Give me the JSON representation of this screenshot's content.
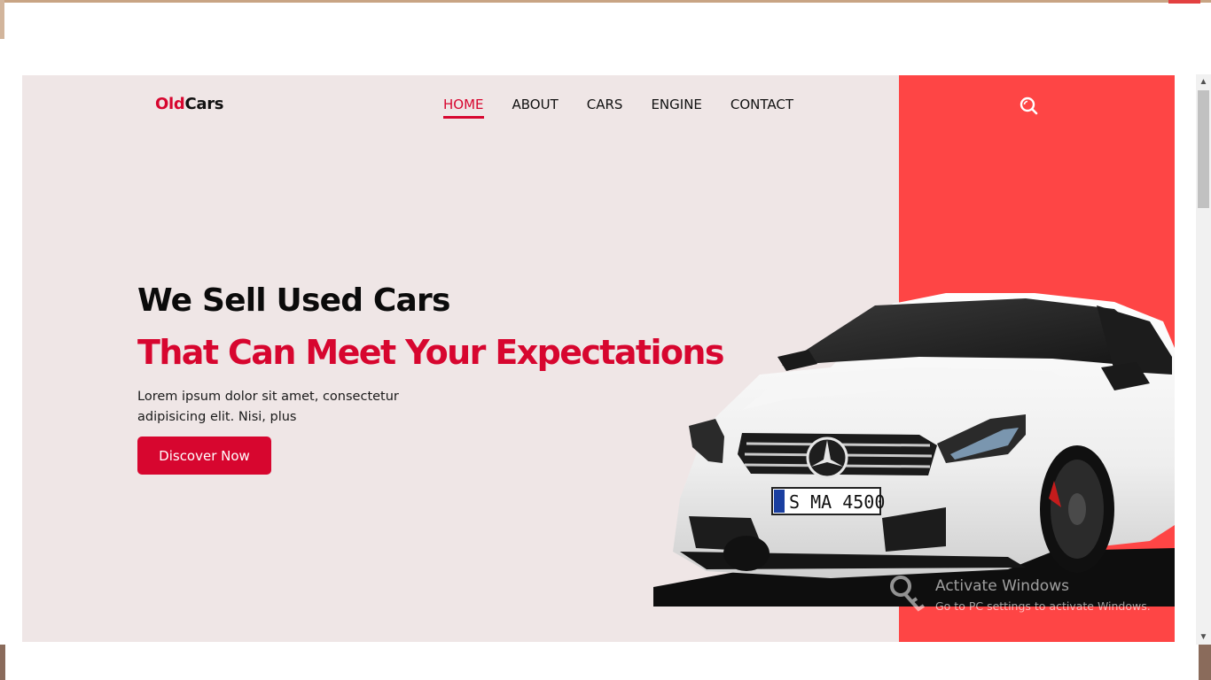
{
  "brand": {
    "part1": "Old",
    "part2": "Cars"
  },
  "nav": {
    "items": [
      {
        "label": "HOME",
        "active": true
      },
      {
        "label": "ABOUT",
        "active": false
      },
      {
        "label": "CARS",
        "active": false
      },
      {
        "label": "ENGINE",
        "active": false
      },
      {
        "label": "CONTACT",
        "active": false
      }
    ]
  },
  "search": {
    "icon": "search-icon"
  },
  "hero": {
    "headline": "We Sell Used Cars",
    "subheadline": "That Can Meet Your Expectations",
    "description": "Lorem ipsum dolor sit amet, consectetur adipisicing elit. Nisi, plus",
    "cta_label": "Discover Now",
    "plate_text": "S MA 4500"
  },
  "watermark": {
    "title": "Activate Windows",
    "subtitle": "Go to PC settings to activate Windows."
  },
  "colors": {
    "accent": "#d7062f",
    "panel_red": "#fe4545",
    "hero_bg": "#efe6e6"
  }
}
